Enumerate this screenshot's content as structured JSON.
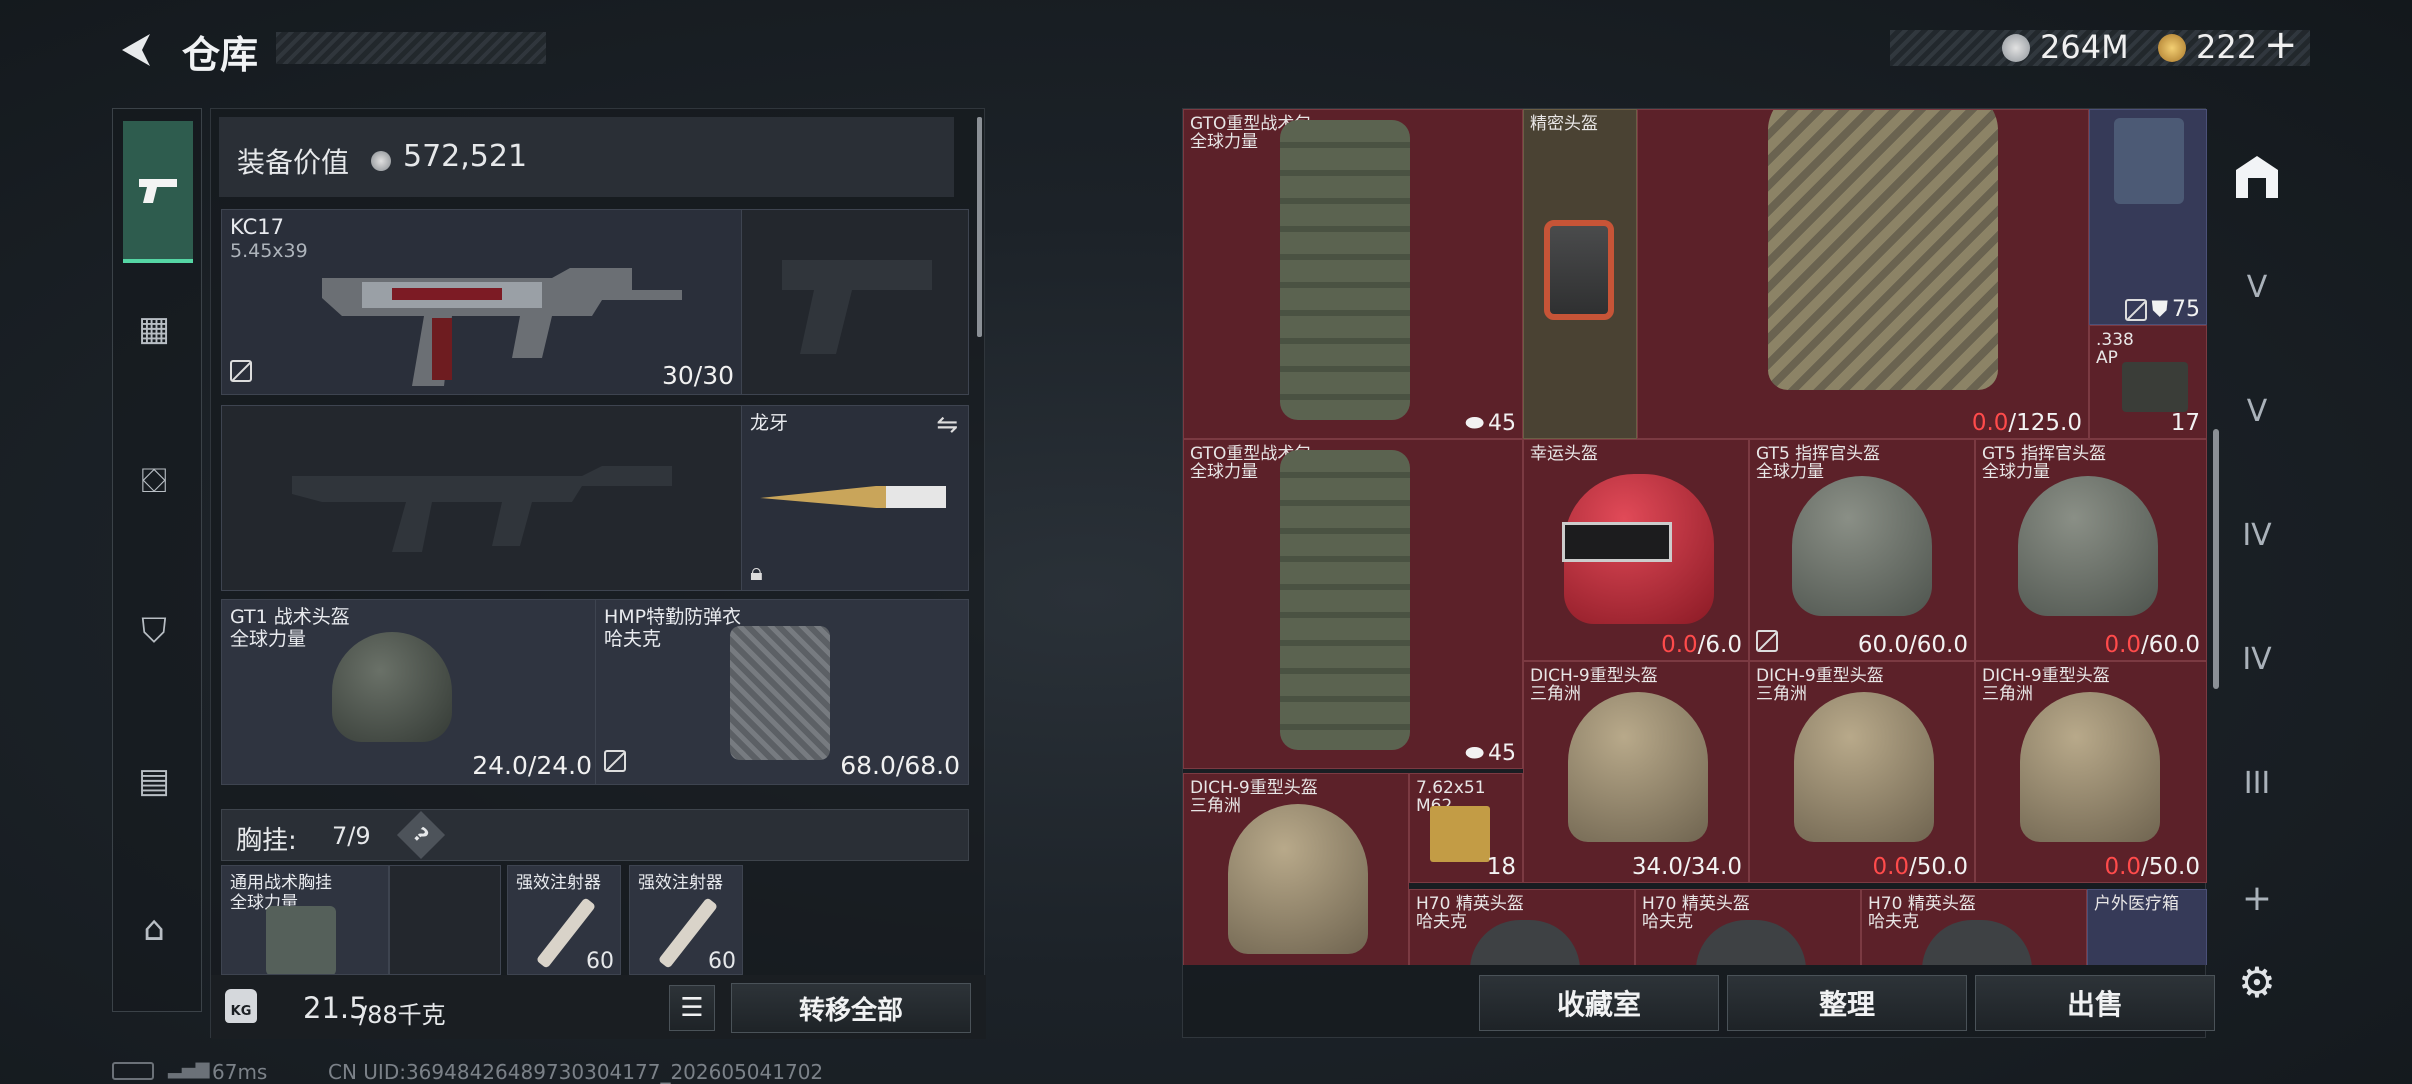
{
  "header": {
    "title": "仓库",
    "currency_silver": "264M",
    "currency_gold": "222",
    "add_symbol": "+"
  },
  "equipment_panel": {
    "value_label": "装备价值",
    "value": "572,521",
    "primary": {
      "name": "KC17",
      "caliber": "5.45x39",
      "ammo": "30/30"
    },
    "melee": {
      "name": "龙牙"
    },
    "helmet": {
      "name": "GT1 战术头盔",
      "brand": "全球力量",
      "durability": "24.0/24.0"
    },
    "armor": {
      "name": "HMP特勤防弹衣",
      "brand": "哈夫克",
      "durability": "68.0/68.0"
    },
    "chest_rig": {
      "label": "胸挂:",
      "count": "7/9",
      "help": "?"
    },
    "rig_items": [
      {
        "name": "通用战术胸挂",
        "brand": "全球力量"
      },
      {
        "name": "强效注射器",
        "count": "60"
      },
      {
        "name": "强效注射器",
        "count": "60"
      }
    ],
    "weight_value": "21.5",
    "weight_max": "/88千克",
    "kg_label": "KG",
    "transfer_all": "转移全部"
  },
  "storage": {
    "items": [
      {
        "name": "GTO重型战术包",
        "brand": "全球力量",
        "badge": "45"
      },
      {
        "name": "精密头盔"
      },
      {
        "badge": "75"
      },
      {
        "cur": "0.0",
        "max": "/125.0"
      },
      {
        "badge": "75"
      },
      {
        "name": ".338",
        "sub": "AP",
        "count": "17"
      },
      {
        "name": "GTO重型战术包",
        "brand": "全球力量",
        "badge": "45"
      },
      {
        "name": "幸运头盔",
        "cur": "0.0",
        "max": "/6.0"
      },
      {
        "name": "GT5 指挥官头盔",
        "brand": "全球力量",
        "val": "60.0/60.0"
      },
      {
        "name": "GT5 指挥官头盔",
        "brand": "全球力量",
        "cur": "0.0",
        "max": "/60.0"
      },
      {
        "name": "DICH-9重型头盔",
        "brand": "三角洲",
        "val": "34.0/34.0"
      },
      {
        "name": "DICH-9重型头盔",
        "brand": "三角洲",
        "cur": "0.0",
        "max": "/50.0"
      },
      {
        "name": "DICH-9重型头盔",
        "brand": "三角洲",
        "cur": "0.0",
        "max": "/50.0"
      },
      {
        "name": "DICH-9重型头盔",
        "brand": "三角洲"
      },
      {
        "name": "7.62x51",
        "sub": "M62",
        "count": "18"
      },
      {
        "name": "H70 精英头盔",
        "brand": "哈夫克"
      },
      {
        "name": "H70 精英头盔",
        "brand": "哈夫克"
      },
      {
        "name": "H70 精英头盔",
        "brand": "哈夫克"
      },
      {
        "name": "户外医疗箱"
      }
    ],
    "buttons": {
      "collection": "收藏室",
      "organize": "整理",
      "sell": "出售"
    }
  },
  "right_sidebar": {
    "labels": [
      "V",
      "V",
      "IV",
      "IV",
      "III"
    ],
    "add": "+"
  },
  "status": {
    "ping": "67ms",
    "uid": "CN UID:36948426489730304177_202605041702"
  },
  "colors": {
    "red_cell": "#5c2129",
    "zero_red": "#ff4b4b",
    "panel": "#2a2f3a"
  }
}
